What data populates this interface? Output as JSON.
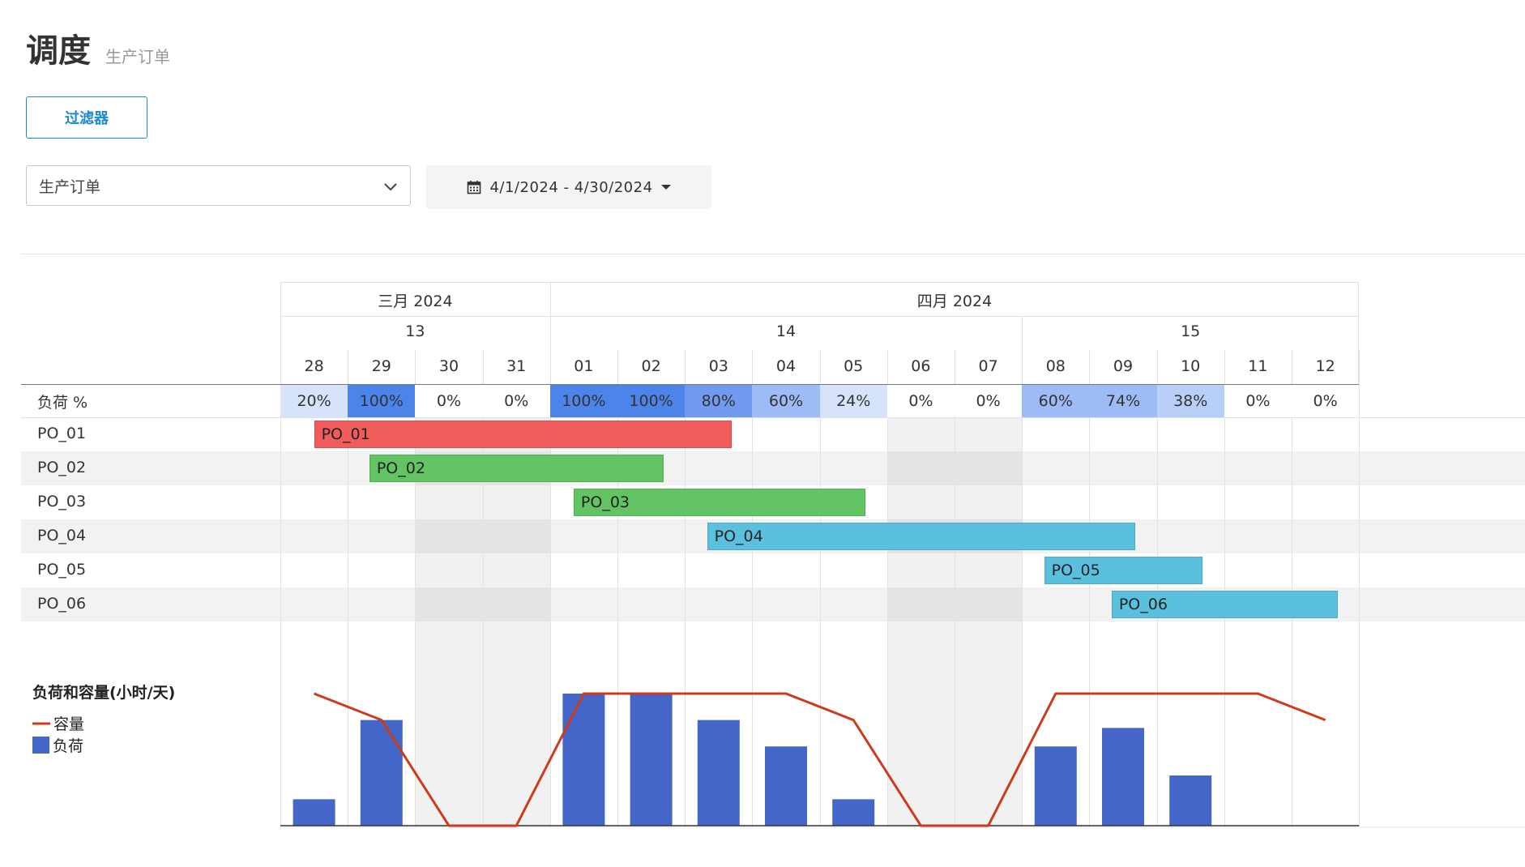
{
  "header": {
    "title": "调度",
    "subtitle": "生产订单"
  },
  "toolbar": {
    "filter_label": "过滤器",
    "order_type_selected": "生产订单",
    "date_range": "4/1/2024 - 4/30/2024"
  },
  "timeline": {
    "months": [
      {
        "label": "三月 2024",
        "span": 4
      },
      {
        "label": "四月 2024",
        "span": 12
      }
    ],
    "weeks": [
      {
        "label": "13",
        "span": 4
      },
      {
        "label": "14",
        "span": 7
      },
      {
        "label": "15",
        "span": 5
      }
    ],
    "days": [
      "28",
      "29",
      "30",
      "31",
      "01",
      "02",
      "03",
      "04",
      "05",
      "06",
      "07",
      "08",
      "09",
      "10",
      "11",
      "12"
    ],
    "weekend_day_indices": [
      2,
      3,
      9,
      10
    ]
  },
  "load_row": {
    "label": "负荷 %",
    "values": [
      "20%",
      "100%",
      "0%",
      "0%",
      "100%",
      "100%",
      "80%",
      "60%",
      "24%",
      "0%",
      "0%",
      "60%",
      "74%",
      "38%",
      "0%",
      "0%"
    ],
    "levels": [
      20,
      100,
      0,
      0,
      100,
      100,
      80,
      60,
      24,
      0,
      0,
      60,
      74,
      38,
      0,
      0
    ]
  },
  "orders": [
    {
      "label": "PO_01",
      "bar_label": "PO_01",
      "start": 0.5,
      "end": 6.7,
      "color": "#f05c5c"
    },
    {
      "label": "PO_02",
      "bar_label": "PO_02",
      "start": 1.32,
      "end": 5.68,
      "color": "#62c462"
    },
    {
      "label": "PO_03",
      "bar_label": "PO_03",
      "start": 4.35,
      "end": 8.68,
      "color": "#62c462"
    },
    {
      "label": "PO_04",
      "bar_label": "PO_04",
      "start": 6.33,
      "end": 12.68,
      "color": "#5bc0de"
    },
    {
      "label": "PO_05",
      "bar_label": "PO_05",
      "start": 11.33,
      "end": 13.68,
      "color": "#5bc0de"
    },
    {
      "label": "PO_06",
      "bar_label": "PO_06",
      "start": 12.33,
      "end": 15.68,
      "color": "#5bc0de"
    }
  ],
  "legend": {
    "title": "负荷和容量(小时/天)",
    "capacity_label": "容量",
    "load_label": "负荷"
  },
  "colors": {
    "load_bar": "#4466c8",
    "capacity_line": "#cc3b1c",
    "accent": "#1a8ad4"
  },
  "chart_data": {
    "type": "bar",
    "categories": [
      "28",
      "29",
      "30",
      "31",
      "01",
      "02",
      "03",
      "04",
      "05",
      "06",
      "07",
      "08",
      "09",
      "10",
      "11",
      "12"
    ],
    "series": [
      {
        "name": "负荷",
        "type": "bar",
        "values": [
          2,
          8,
          0,
          0,
          10,
          10,
          8,
          6,
          2,
          0,
          0,
          6,
          7.4,
          3.8,
          0,
          0
        ]
      },
      {
        "name": "容量",
        "type": "line",
        "values": [
          10,
          8,
          0,
          0,
          10,
          10,
          10,
          10,
          8,
          0,
          0,
          10,
          10,
          10,
          10,
          8
        ]
      }
    ],
    "title": "负荷和容量(小时/天)",
    "ylim": [
      0,
      10
    ]
  }
}
